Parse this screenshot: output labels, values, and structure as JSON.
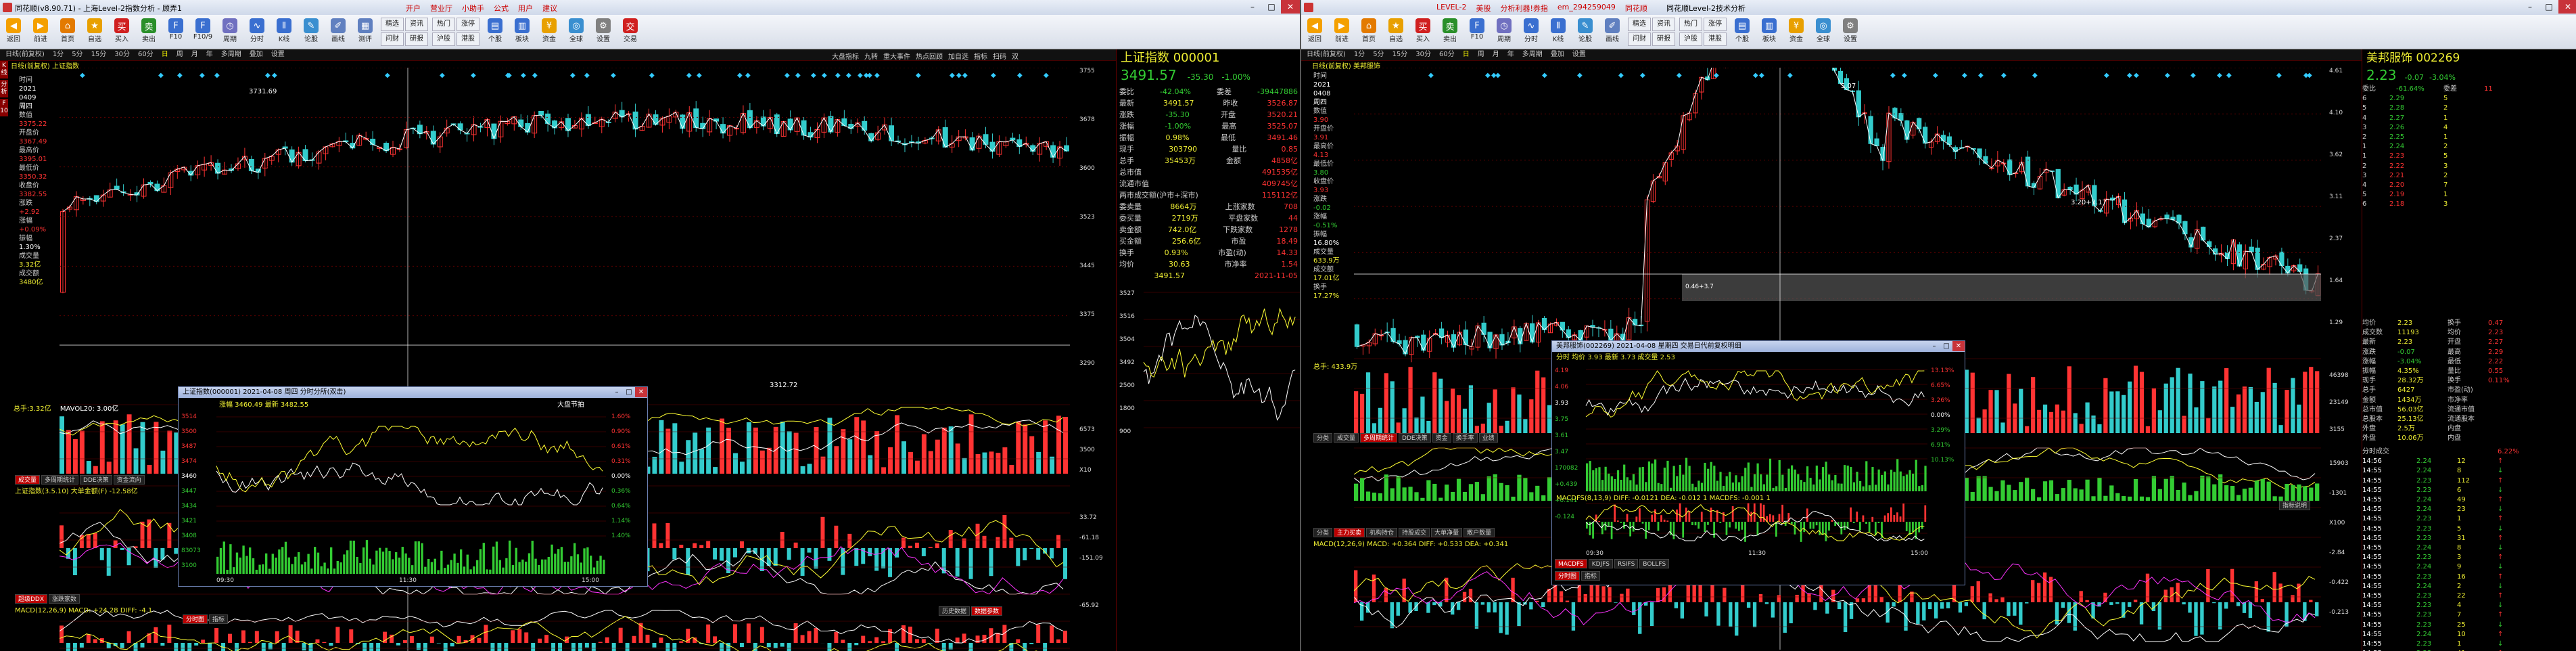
{
  "left": {
    "title": "同花顺(v8.90.71) - 上海Level-2指数分析 - 顾弄1",
    "menus": [
      "开户",
      "营业厅",
      "小助手",
      "公式",
      "用户",
      "建议"
    ],
    "toolbar": [
      {
        "label": "返回",
        "icon": "back-icon",
        "color": "#f4a000",
        "ch": "◀"
      },
      {
        "label": "前进",
        "icon": "forward-icon",
        "color": "#f4a000",
        "ch": "▶"
      },
      {
        "label": "首页",
        "icon": "home-icon",
        "color": "#e37a00",
        "ch": "⌂"
      },
      {
        "label": "自选",
        "icon": "favorites-icon",
        "color": "#e8a000",
        "ch": "★"
      },
      {
        "label": "买入",
        "icon": "buy-icon",
        "color": "#d02020",
        "ch": "买"
      },
      {
        "label": "卖出",
        "icon": "sell-icon",
        "color": "#2a8f2a",
        "ch": "卖"
      },
      {
        "label": "F10",
        "icon": "f10-icon",
        "color": "#3a6fd0",
        "ch": "F"
      },
      {
        "label": "F10/9",
        "icon": "f109-icon",
        "color": "#3a6fd0",
        "ch": "F"
      },
      {
        "label": "周期",
        "icon": "period-icon",
        "color": "#7070c0",
        "ch": "◷"
      },
      {
        "label": "分时",
        "icon": "timeshare-icon",
        "color": "#3a6fd0",
        "ch": "∿"
      },
      {
        "label": "K线",
        "icon": "kline-icon",
        "color": "#3a6fd0",
        "ch": "Ⅱ"
      },
      {
        "label": "论股",
        "icon": "forum-icon",
        "color": "#3a8fd0",
        "ch": "✎"
      },
      {
        "label": "画线",
        "icon": "draw-icon",
        "color": "#6080c0",
        "ch": "✐"
      },
      {
        "label": "测评",
        "icon": "assess-icon",
        "color": "#6080c0",
        "ch": "▦"
      }
    ],
    "toolbar_grid1": [
      "精选",
      "资讯",
      "问财",
      "研报",
      "自选",
      "股东"
    ],
    "toolbar_grid2": [
      "热门",
      "涨停",
      "沪股",
      "港股",
      "资金",
      "ETF"
    ],
    "toolbar_right": [
      {
        "label": "个股",
        "icon": "stock-icon",
        "color": "#3a6fd0",
        "ch": "▤"
      },
      {
        "label": "板块",
        "icon": "sector-icon",
        "color": "#3a6fd0",
        "ch": "▥"
      },
      {
        "label": "资金",
        "icon": "fund-icon",
        "color": "#e8a000",
        "ch": "¥"
      },
      {
        "label": "全球",
        "icon": "globe-icon",
        "color": "#3a8fd0",
        "ch": "◎"
      },
      {
        "label": "设置",
        "icon": "settings-icon",
        "color": "#808080",
        "ch": "⚙"
      },
      {
        "label": "交易",
        "icon": "trade-icon",
        "color": "#d02020",
        "ch": "交"
      }
    ],
    "tabbar": [
      "日线(前复权)",
      "1分",
      "5分",
      "15分",
      "30分",
      "60分",
      "日",
      "周",
      "月",
      "年",
      "多周期",
      "叠加",
      "设置"
    ],
    "chart_tag": "日线(前复权)  上证指数",
    "kline_panel": [
      {
        "k": "时间",
        "v": "",
        "c": "wht"
      },
      {
        "k": "",
        "v": "2021",
        "c": "wht"
      },
      {
        "k": "",
        "v": "0409",
        "c": "wht"
      },
      {
        "k": "",
        "v": "周四",
        "c": "wht"
      },
      {
        "k": "数值",
        "v": "",
        "c": "lbl"
      },
      {
        "k": "",
        "v": "3375.22",
        "c": "red"
      },
      {
        "k": "开盘价",
        "v": "",
        "c": "lbl"
      },
      {
        "k": "",
        "v": "3367.49",
        "c": "red"
      },
      {
        "k": "最高价",
        "v": "",
        "c": "lbl"
      },
      {
        "k": "",
        "v": "3395.01",
        "c": "red"
      },
      {
        "k": "最低价",
        "v": "",
        "c": "lbl"
      },
      {
        "k": "",
        "v": "3350.32",
        "c": "red"
      },
      {
        "k": "收盘价",
        "v": "",
        "c": "lbl"
      },
      {
        "k": "",
        "v": "3382.55",
        "c": "red"
      },
      {
        "k": "涨跌",
        "v": "",
        "c": "lbl"
      },
      {
        "k": "",
        "v": "+2.92",
        "c": "red"
      },
      {
        "k": "涨幅",
        "v": "",
        "c": "lbl"
      },
      {
        "k": "",
        "v": "+0.09%",
        "c": "red"
      },
      {
        "k": "振幅",
        "v": "",
        "c": "lbl"
      },
      {
        "k": "",
        "v": "1.30%",
        "c": "wht"
      },
      {
        "k": "成交量",
        "v": "",
        "c": "lbl"
      },
      {
        "k": "",
        "v": "3.32亿",
        "c": "yel"
      },
      {
        "k": "成交额",
        "v": "",
        "c": "lbl"
      },
      {
        "k": "",
        "v": "3480亿",
        "c": "yel"
      }
    ],
    "price_axis": [
      "3755",
      "3678",
      "3600",
      "3523",
      "3445",
      "3375",
      "3290"
    ],
    "price_axis_mark": "3375",
    "annot_high": "3731.69",
    "annot_low": "3312.72",
    "right_toolbar": [
      "大盘指标",
      "九转",
      "重大事件",
      "热点回顾",
      "加自选",
      "指标",
      "扫码",
      "双"
    ],
    "vol_header": {
      "label": "总手:3.32亿",
      "ma": "MAVOL20: 3.00亿"
    },
    "vol_axis": [
      "6573",
      "3500",
      "X10"
    ],
    "macd_tabs": [
      "成交量",
      "多周期统计",
      "DDE决策",
      "资金流向"
    ],
    "macd_tabs_right": "指标说明",
    "macd_header": "上证指数(3.5.10)  大单金额(F) -12.58亿",
    "macd_axis": [
      "33.72",
      "-61.18",
      "-151.09"
    ],
    "ind_tabs": [
      "超级DDX",
      "涨跌家数"
    ],
    "ind_header": "MACD(12,26,9)  MACD: +24.28  DIFF: -4.1",
    "ind_axis_right": "指标说明",
    "bottom_tabs": [
      "分时图",
      "指标"
    ],
    "bottom_right_tabs": [
      "历史数据",
      "数据参数"
    ],
    "bottom_axis": "-65.92",
    "quote": {
      "title": "上证指数 000001",
      "price": "3491.57",
      "chg": "-35.30",
      "pct": "-1.00%",
      "rows": [
        [
          "委比",
          "-42.04%",
          "委差",
          "-39447886"
        ],
        [
          "最新",
          "3491.57",
          "昨收",
          "3526.87"
        ],
        [
          "涨跌",
          "-35.30",
          "开盘",
          "3520.21"
        ],
        [
          "涨幅",
          "-1.00%",
          "最高",
          "3525.07"
        ],
        [
          "振幅",
          "0.98%",
          "最低",
          "3491.46"
        ],
        [
          "现手",
          "303790",
          "量比",
          "0.85"
        ],
        [
          "总手",
          "35453万",
          "金额",
          "4858亿"
        ],
        [
          "总市值",
          "",
          "",
          "491535亿"
        ],
        [
          "流通市值",
          "",
          "",
          "409745亿"
        ],
        [
          "两市成交额(沪市+深市)",
          "",
          "",
          "115112亿"
        ],
        [
          "委卖量",
          "8664万",
          "上涨家数",
          "708"
        ],
        [
          "委买量",
          "2719万",
          "平盘家数",
          "44"
        ],
        [
          "卖金额",
          "742.0亿",
          "下跌家数",
          "1278"
        ],
        [
          "买金额",
          "256.6亿",
          "市盈",
          "18.49"
        ],
        [
          "换手",
          "0.93%",
          "市盈(动)",
          "14.33"
        ],
        [
          "均价",
          "30.63",
          "市净率",
          "1.54"
        ],
        [
          "",
          "3491.57",
          "",
          "2021-11-05"
        ]
      ],
      "mini_axis": [
        "3527",
        "3516",
        "3504",
        "3492",
        "2500",
        "1800",
        "900"
      ]
    },
    "popup": {
      "title": "上证指数(000001)  2021-04-08  周四   分时分所(双击)",
      "header": "涨幅  3460.49  最新  3482.55",
      "sub_label": "大盘节拍",
      "y_left": [
        "3514",
        "3500",
        "3487",
        "3474",
        "3460",
        "3447",
        "3434",
        "3421",
        "3408",
        "83073",
        "3100"
      ],
      "y_right": [
        "1.60%",
        "0.90%",
        "0.61%",
        "0.31%",
        "0.00%",
        "0.36%",
        "0.64%",
        "1.14%",
        "1.40%"
      ],
      "x_labels": [
        "09:30",
        "11:30",
        "15:00"
      ]
    }
  },
  "right": {
    "title": "同花顺Level-2技术分析",
    "topbar": [
      "LEVEL-2",
      "美股",
      "分析利器!券指",
      "em_294259049",
      "同花顺"
    ],
    "toolbar": [
      {
        "label": "返回",
        "icon": "back-icon",
        "color": "#f4a000",
        "ch": "◀"
      },
      {
        "label": "前进",
        "icon": "forward-icon",
        "color": "#f4a000",
        "ch": "▶"
      },
      {
        "label": "首页",
        "icon": "home-icon",
        "color": "#e37a00",
        "ch": "⌂"
      },
      {
        "label": "自选",
        "icon": "favorites-icon",
        "color": "#e8a000",
        "ch": "★"
      },
      {
        "label": "买入",
        "icon": "buy-icon",
        "color": "#d02020",
        "ch": "买"
      },
      {
        "label": "卖出",
        "icon": "sell-icon",
        "color": "#2a8f2a",
        "ch": "卖"
      },
      {
        "label": "F10",
        "icon": "f10-icon",
        "color": "#3a6fd0",
        "ch": "F"
      },
      {
        "label": "周期",
        "icon": "period-icon",
        "color": "#7070c0",
        "ch": "◷"
      },
      {
        "label": "分时",
        "icon": "timeshare-icon",
        "color": "#3a6fd0",
        "ch": "∿"
      },
      {
        "label": "K线",
        "icon": "kline-icon",
        "color": "#3a6fd0",
        "ch": "Ⅱ"
      },
      {
        "label": "论股",
        "icon": "forum-icon",
        "color": "#3a8fd0",
        "ch": "✎"
      },
      {
        "label": "画线",
        "icon": "draw-icon",
        "color": "#6080c0",
        "ch": "✐"
      }
    ],
    "toolbar_grid1": [
      "精选",
      "资讯",
      "问财",
      "研报",
      "自选",
      "股东"
    ],
    "toolbar_grid2": [
      "热门",
      "涨停",
      "沪股",
      "港股",
      "资金",
      "ETF"
    ],
    "toolbar_right": [
      {
        "label": "个股",
        "icon": "stock-icon",
        "color": "#3a6fd0",
        "ch": "▤"
      },
      {
        "label": "板块",
        "icon": "sector-icon",
        "color": "#3a6fd0",
        "ch": "▥"
      },
      {
        "label": "资金",
        "icon": "fund-icon",
        "color": "#e8a000",
        "ch": "¥"
      },
      {
        "label": "全球",
        "icon": "globe-icon",
        "color": "#3a8fd0",
        "ch": "◎"
      },
      {
        "label": "设置",
        "icon": "settings-icon",
        "color": "#808080",
        "ch": "⚙"
      }
    ],
    "tabbar": [
      "日线(前复权)",
      "1分",
      "5分",
      "15分",
      "30分",
      "60分",
      "日",
      "周",
      "月",
      "年",
      "多周期",
      "叠加",
      "设置"
    ],
    "chart_tag": "日线(前复权)  美邦服饰",
    "kline_panel": [
      {
        "k": "时间",
        "c": "lbl"
      },
      {
        "k": "2021",
        "c": "wht"
      },
      {
        "k": "0408",
        "c": "wht"
      },
      {
        "k": "周四",
        "c": "wht"
      },
      {
        "k": "数值",
        "c": "lbl"
      },
      {
        "k": "3.90",
        "c": "red"
      },
      {
        "k": "开盘价",
        "c": "lbl"
      },
      {
        "k": "3.91",
        "c": "red"
      },
      {
        "k": "最高价",
        "c": "lbl"
      },
      {
        "k": "4.13",
        "c": "red"
      },
      {
        "k": "最低价",
        "c": "lbl"
      },
      {
        "k": "3.80",
        "c": "grn"
      },
      {
        "k": "收盘价",
        "c": "lbl"
      },
      {
        "k": "3.93",
        "c": "red"
      },
      {
        "k": "涨跌",
        "c": "lbl"
      },
      {
        "k": "-0.02",
        "c": "grn"
      },
      {
        "k": "涨幅",
        "c": "lbl"
      },
      {
        "k": "-0.51%",
        "c": "grn"
      },
      {
        "k": "振幅",
        "c": "lbl"
      },
      {
        "k": "16.80%",
        "c": "wht"
      },
      {
        "k": "成交量",
        "c": "lbl"
      },
      {
        "k": "633.9万",
        "c": "yel"
      },
      {
        "k": "成交额",
        "c": "lbl"
      },
      {
        "k": "17.01亿",
        "c": "yel"
      },
      {
        "k": "换手",
        "c": "lbl"
      },
      {
        "k": "17.27%",
        "c": "yel"
      }
    ],
    "price_axis": [
      "4.61",
      "4.10",
      "3.62",
      "3.11",
      "2.37",
      "1.64",
      "1.29"
    ],
    "annot_high": "5.07",
    "annot_mid": "3.20+3.17",
    "annot_box": "0.46+3.7",
    "vol_header": "总手: 433.9万",
    "vol_axis": [
      "46398",
      "23149",
      "3155"
    ],
    "sub_tabs1": [
      "分类",
      "成交量",
      "多周期统计",
      "DDE决策",
      "资金",
      "换手率",
      "业绩"
    ],
    "sub_tabs2": [
      "分类",
      "主力买卖",
      "机构持仓",
      "持股成交",
      "大单净量",
      "散户数量"
    ],
    "sub_tabs3": [
      "MACDFS",
      "KDJFS",
      "RSIFS",
      "BOLLFS"
    ],
    "macd_header": "MACD(12,26,9)  MACD: +0.364  DIFF: +0.533  DEA: +0.341",
    "right_axis_mid": [
      "15903",
      "-1301",
      "X100",
      "-2.84",
      "-0.422",
      "-0.213"
    ],
    "ind_right": "指标说明",
    "popup": {
      "title": "美邦服饰(002269)  2021-04-08  星期四    交易日代前复权明细",
      "header": "分时  均价  3.93  最新  3.73  成交量  2.53",
      "y_left": [
        "4.19",
        "4.06",
        "3.93",
        "3.75",
        "3.61",
        "3.47",
        "170082",
        "+0.439",
        "+0.141",
        "-0.124"
      ],
      "y_right": [
        "13.13%",
        "6.65%",
        "3.26%",
        "0.00%",
        "3.29%",
        "6.91%",
        "10.13%"
      ],
      "macd": "MACDFS(8,13,9)  DIFF: -0.0121  DEA: -0.012 1   MACDFS: -0.001 1",
      "x_labels": [
        "09:30",
        "11:30",
        "15:00"
      ],
      "tabs": [
        "MACDFS",
        "KDJFS",
        "RSIFS",
        "BOLLFS"
      ],
      "bottom_tabs": [
        "分时图",
        "指标"
      ]
    },
    "quote": {
      "title": "美邦服饰  002269",
      "price": "2.23",
      "chg": "-0.07",
      "pct": "-3.04%",
      "wb": [
        "委比",
        "-61.64%",
        "委差",
        "11"
      ],
      "sell": [
        [
          "6",
          "2.29",
          "5"
        ],
        [
          "5",
          "2.28",
          "2"
        ],
        [
          "4",
          "2.27",
          "1"
        ],
        [
          "3",
          "2.26",
          "4"
        ],
        [
          "2",
          "2.25",
          "1"
        ],
        [
          "1",
          "2.24",
          "2"
        ]
      ],
      "buy": [
        [
          "1",
          "2.23",
          "5"
        ],
        [
          "2",
          "2.22",
          "3"
        ],
        [
          "3",
          "2.21",
          "2"
        ],
        [
          "4",
          "2.20",
          "7"
        ],
        [
          "5",
          "2.19",
          "1"
        ],
        [
          "6",
          "2.18",
          "3"
        ]
      ],
      "stats": [
        [
          "均价",
          "2.23",
          "换手",
          "0.47"
        ],
        [
          "成交数",
          "11193",
          "均价",
          "2.23"
        ],
        [
          "最新",
          "2.23",
          "开盘",
          "2.27"
        ],
        [
          "涨跌",
          "-0.07",
          "最高",
          "2.29"
        ],
        [
          "涨幅",
          "-3.04%",
          "最低",
          "2.22"
        ],
        [
          "振幅",
          "4.35%",
          "量比",
          "0.55"
        ],
        [
          "现手",
          "28.32万",
          "换手",
          "0.11%"
        ],
        [
          "总手",
          "6427",
          "市盈(动)",
          ""
        ],
        [
          "金额",
          "1434万",
          "市净率",
          ""
        ],
        [
          "总市值",
          "56.03亿",
          "流通市值",
          ""
        ],
        [
          "总股本",
          "25.13亿",
          "流通股本",
          ""
        ],
        [
          "外盘",
          "2.5万",
          "内盘",
          ""
        ],
        [
          "外盘",
          "10.06万",
          "内盘",
          ""
        ]
      ],
      "ticks_header": [
        "分时成交",
        "",
        "",
        "6.22%"
      ],
      "ticks": [
        [
          "14:56",
          "2.24",
          "12",
          "↑"
        ],
        [
          "14:55",
          "2.24",
          "8",
          "↓"
        ],
        [
          "14:55",
          "2.23",
          "112",
          "↑"
        ],
        [
          "14:55",
          "2.23",
          "6",
          "↓"
        ],
        [
          "14:55",
          "2.24",
          "49",
          "↑"
        ],
        [
          "14:55",
          "2.24",
          "23",
          "↓"
        ],
        [
          "14:55",
          "2.23",
          "1",
          "↑"
        ],
        [
          "14:55",
          "2.23",
          "5",
          "↓"
        ],
        [
          "14:55",
          "2.23",
          "31",
          "↑"
        ],
        [
          "14:55",
          "2.24",
          "8",
          "↓"
        ],
        [
          "14:55",
          "2.23",
          "3",
          "↑"
        ],
        [
          "14:55",
          "2.24",
          "9",
          "↓"
        ],
        [
          "14:55",
          "2.23",
          "16",
          "↑"
        ],
        [
          "14:55",
          "2.24",
          "2",
          "↓"
        ],
        [
          "14:55",
          "2.23",
          "22",
          "↑"
        ],
        [
          "14:55",
          "2.23",
          "4",
          "↓"
        ],
        [
          "14:55",
          "2.23",
          "7",
          "↑"
        ],
        [
          "14:55",
          "2.23",
          "25",
          "↓"
        ],
        [
          "14:55",
          "2.24",
          "10",
          "↑"
        ],
        [
          "14:55",
          "2.23",
          "1",
          "↓"
        ],
        [
          "14:55",
          "2.23",
          "41",
          "↑"
        ]
      ]
    }
  },
  "colors": {
    "up": "#ff3333",
    "down": "#33cccc",
    "ma": "#ffffff",
    "grid": "#660000",
    "bg": "#000000"
  }
}
